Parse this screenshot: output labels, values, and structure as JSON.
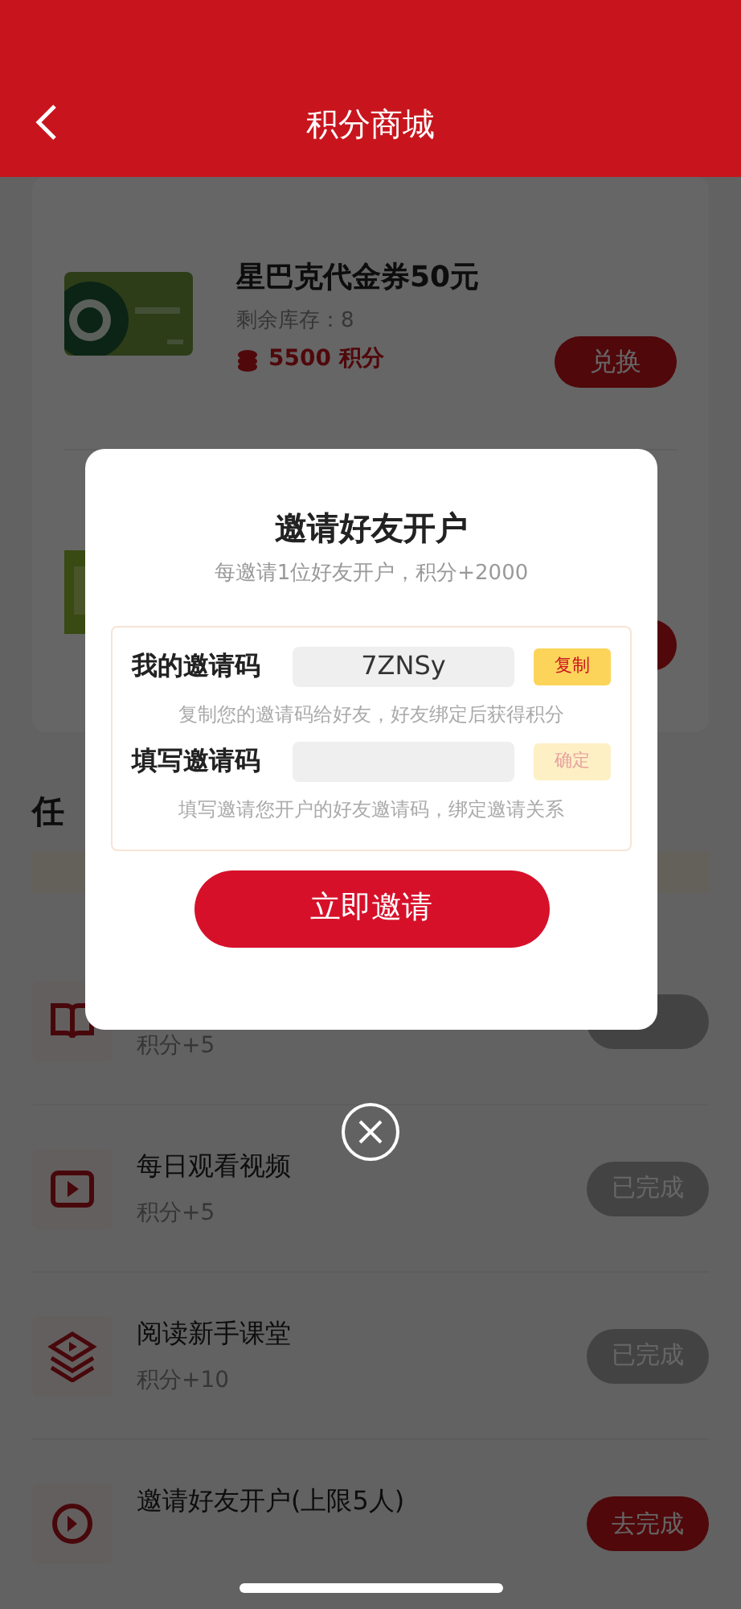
{
  "header": {
    "title": "积分商城"
  },
  "products": [
    {
      "title": "星巴克代金券50元",
      "stock": "剩余库存：8",
      "points": "5500 积分",
      "button": "兑换",
      "kind": "gift-card"
    },
    {
      "kind": "lime-card"
    }
  ],
  "tasks_title": "任",
  "tasks": [
    {
      "kind": "book",
      "points": "积分+5",
      "done": true
    },
    {
      "kind": "video",
      "title": "每日观看视频",
      "points": "积分+5",
      "button": "已完成",
      "done": true
    },
    {
      "kind": "layers",
      "title": "阅读新手课堂",
      "points": "积分+10",
      "button": "已完成",
      "done": true
    },
    {
      "kind": "invite",
      "title": "邀请好友开户(上限5人)",
      "button": "去完成",
      "done": false
    }
  ],
  "dialog": {
    "title": "邀请好友开户",
    "subtitle": "每邀请1位好友开户，积分+2000",
    "rows": [
      {
        "label": "我的邀请码",
        "value": "7ZNSy",
        "button": "复制",
        "disabled": false,
        "hint": "复制您的邀请码给好友，好友绑定后获得积分"
      },
      {
        "label": "填写邀请码",
        "button": "确定",
        "disabled": true,
        "hint": "填写邀请您开户的好友邀请码，绑定邀请关系"
      }
    ],
    "action": "立即邀请"
  }
}
